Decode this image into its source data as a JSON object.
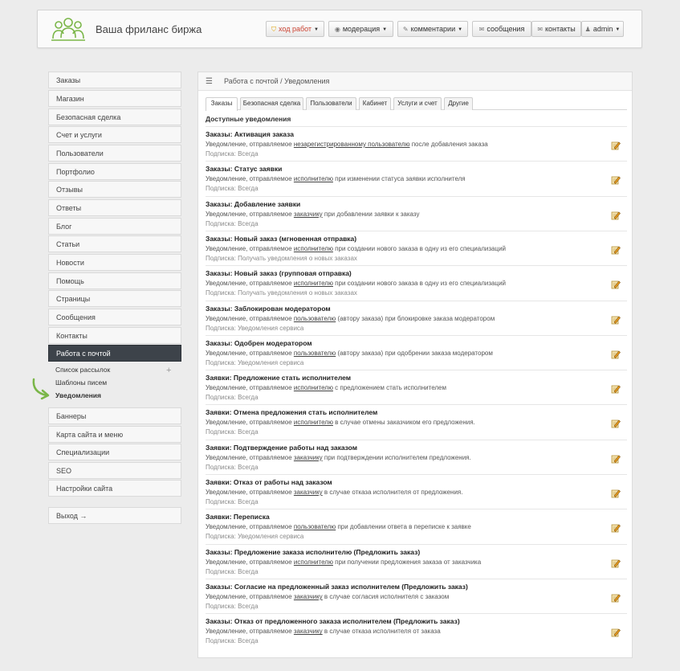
{
  "header": {
    "site_title": "Ваша фриланс биржа",
    "nav": [
      {
        "id": "progress",
        "icon": "shield-icon",
        "label": "ход работ"
      },
      {
        "id": "moderation",
        "icon": "eye-icon",
        "label": "модерация"
      },
      {
        "id": "comments",
        "icon": "pencil-icon",
        "label": "комментарии"
      },
      {
        "id": "messages",
        "icon": "envelope-icon",
        "label": "сообщения"
      },
      {
        "id": "contacts",
        "icon": "envelope-icon",
        "label": "контакты"
      },
      {
        "id": "admin",
        "icon": "user-icon",
        "label": "admin"
      }
    ]
  },
  "sidebar": {
    "items": [
      "Заказы",
      "Магазин",
      "Безопасная сделка",
      "Счет и услуги",
      "Пользователи",
      "Портфолио",
      "Отзывы",
      "Ответы",
      "Блог",
      "Статьи",
      "Новости",
      "Помощь",
      "Страницы",
      "Сообщения",
      "Контакты",
      "Работа с почтой"
    ],
    "sub_items": [
      "Список рассылок",
      "Шаблоны писем",
      "Уведомления"
    ],
    "items_after": [
      "Баннеры",
      "Карта сайта и меню",
      "Специализации",
      "SEO",
      "Настройки сайта"
    ],
    "logout": "Выход →"
  },
  "main": {
    "breadcrumb": "Работа с почтой / Уведомления",
    "tabs": [
      "Заказы",
      "Безопасная сделка",
      "Пользователи",
      "Кабинет",
      "Услуги и счет",
      "Другие"
    ],
    "section_title": "Доступные уведомления",
    "rows": [
      {
        "title": "Заказы: Активация заказа",
        "pre": "Уведомление, отправляемое ",
        "link": "незарегистрированному пользователю",
        "post": " после добавления заказа",
        "sub": "Подписка: Всегда"
      },
      {
        "title": "Заказы: Статус заявки",
        "pre": "Уведомление, отправляемое ",
        "link": "исполнителю",
        "post": " при изменении статуса заявки исполнителя",
        "sub": "Подписка: Всегда"
      },
      {
        "title": "Заказы: Добавление заявки",
        "pre": "Уведомление, отправляемое ",
        "link": "заказчику",
        "post": " при добавлении заявки к заказу",
        "sub": "Подписка: Всегда"
      },
      {
        "title": "Заказы: Новый заказ (мгновенная отправка)",
        "pre": "Уведомление, отправляемое ",
        "link": "исполнителю",
        "post": " при создании нового заказа в одну из его специализаций",
        "sub": "Подписка: Получать уведомления о новых заказах"
      },
      {
        "title": "Заказы: Новый заказ (групповая отправка)",
        "pre": "Уведомление, отправляемое ",
        "link": "исполнителю",
        "post": " при создании нового заказа в одну из его специализаций",
        "sub": "Подписка: Получать уведомления о новых заказах"
      },
      {
        "title": "Заказы: Заблокирован модератором",
        "pre": "Уведомление, отправляемое ",
        "link": "пользователю",
        "post": " (автору заказа) при блокировке заказа модератором",
        "sub": "Подписка: Уведомления сервиса"
      },
      {
        "title": "Заказы: Одобрен модератором",
        "pre": "Уведомление, отправляемое ",
        "link": "пользователю",
        "post": " (автору заказа) при одобрении заказа модератором",
        "sub": "Подписка: Уведомления сервиса"
      },
      {
        "title": "Заявки: Предложение стать исполнителем",
        "pre": "Уведомление, отправляемое ",
        "link": "исполнителю",
        "post": " с предложением стать исполнителем",
        "sub": "Подписка: Всегда"
      },
      {
        "title": "Заявки: Отмена предложения стать исполнителем",
        "pre": "Уведомление, отправляемое ",
        "link": "исполнителю",
        "post": " в случае отмены заказчиком его предложения.",
        "sub": "Подписка: Всегда"
      },
      {
        "title": "Заявки: Подтверждение работы над заказом",
        "pre": "Уведомление, отправляемое ",
        "link": "заказчику",
        "post": " при подтверждении исполнителем предложения.",
        "sub": "Подписка: Всегда"
      },
      {
        "title": "Заявки: Отказ от работы над заказом",
        "pre": "Уведомление, отправляемое ",
        "link": "заказчику",
        "post": " в случае отказа исполнителя от предложения.",
        "sub": "Подписка: Всегда"
      },
      {
        "title": "Заявки: Переписка",
        "pre": "Уведомление, отправляемое ",
        "link": "пользователю",
        "post": " при добавлении ответа в переписке к заявке",
        "sub": "Подписка: Уведомления сервиса"
      },
      {
        "title": "Заказы: Предложение заказа исполнителю (Предложить заказ)",
        "pre": "Уведомление, отправляемое ",
        "link": "исполнителю",
        "post": " при получении предложения заказа от заказчика",
        "sub": "Подписка: Всегда"
      },
      {
        "title": "Заказы: Согласие на предложенный заказ исполнителем (Предложить заказ)",
        "pre": "Уведомление, отправляемое ",
        "link": "заказчику",
        "post": " в случае согласия исполнителя с заказом",
        "sub": "Подписка: Всегда"
      },
      {
        "title": "Заказы: Отказ от предложенного заказа исполнителем (Предложить заказ)",
        "pre": "Уведомление, отправляемое ",
        "link": "заказчику",
        "post": " в случае отказа исполнителя от заказа",
        "sub": "Подписка: Всегда"
      }
    ]
  },
  "colors": {
    "accent_green": "#7ab648",
    "active_dark": "#3d434a",
    "warning": "#e0a000"
  }
}
